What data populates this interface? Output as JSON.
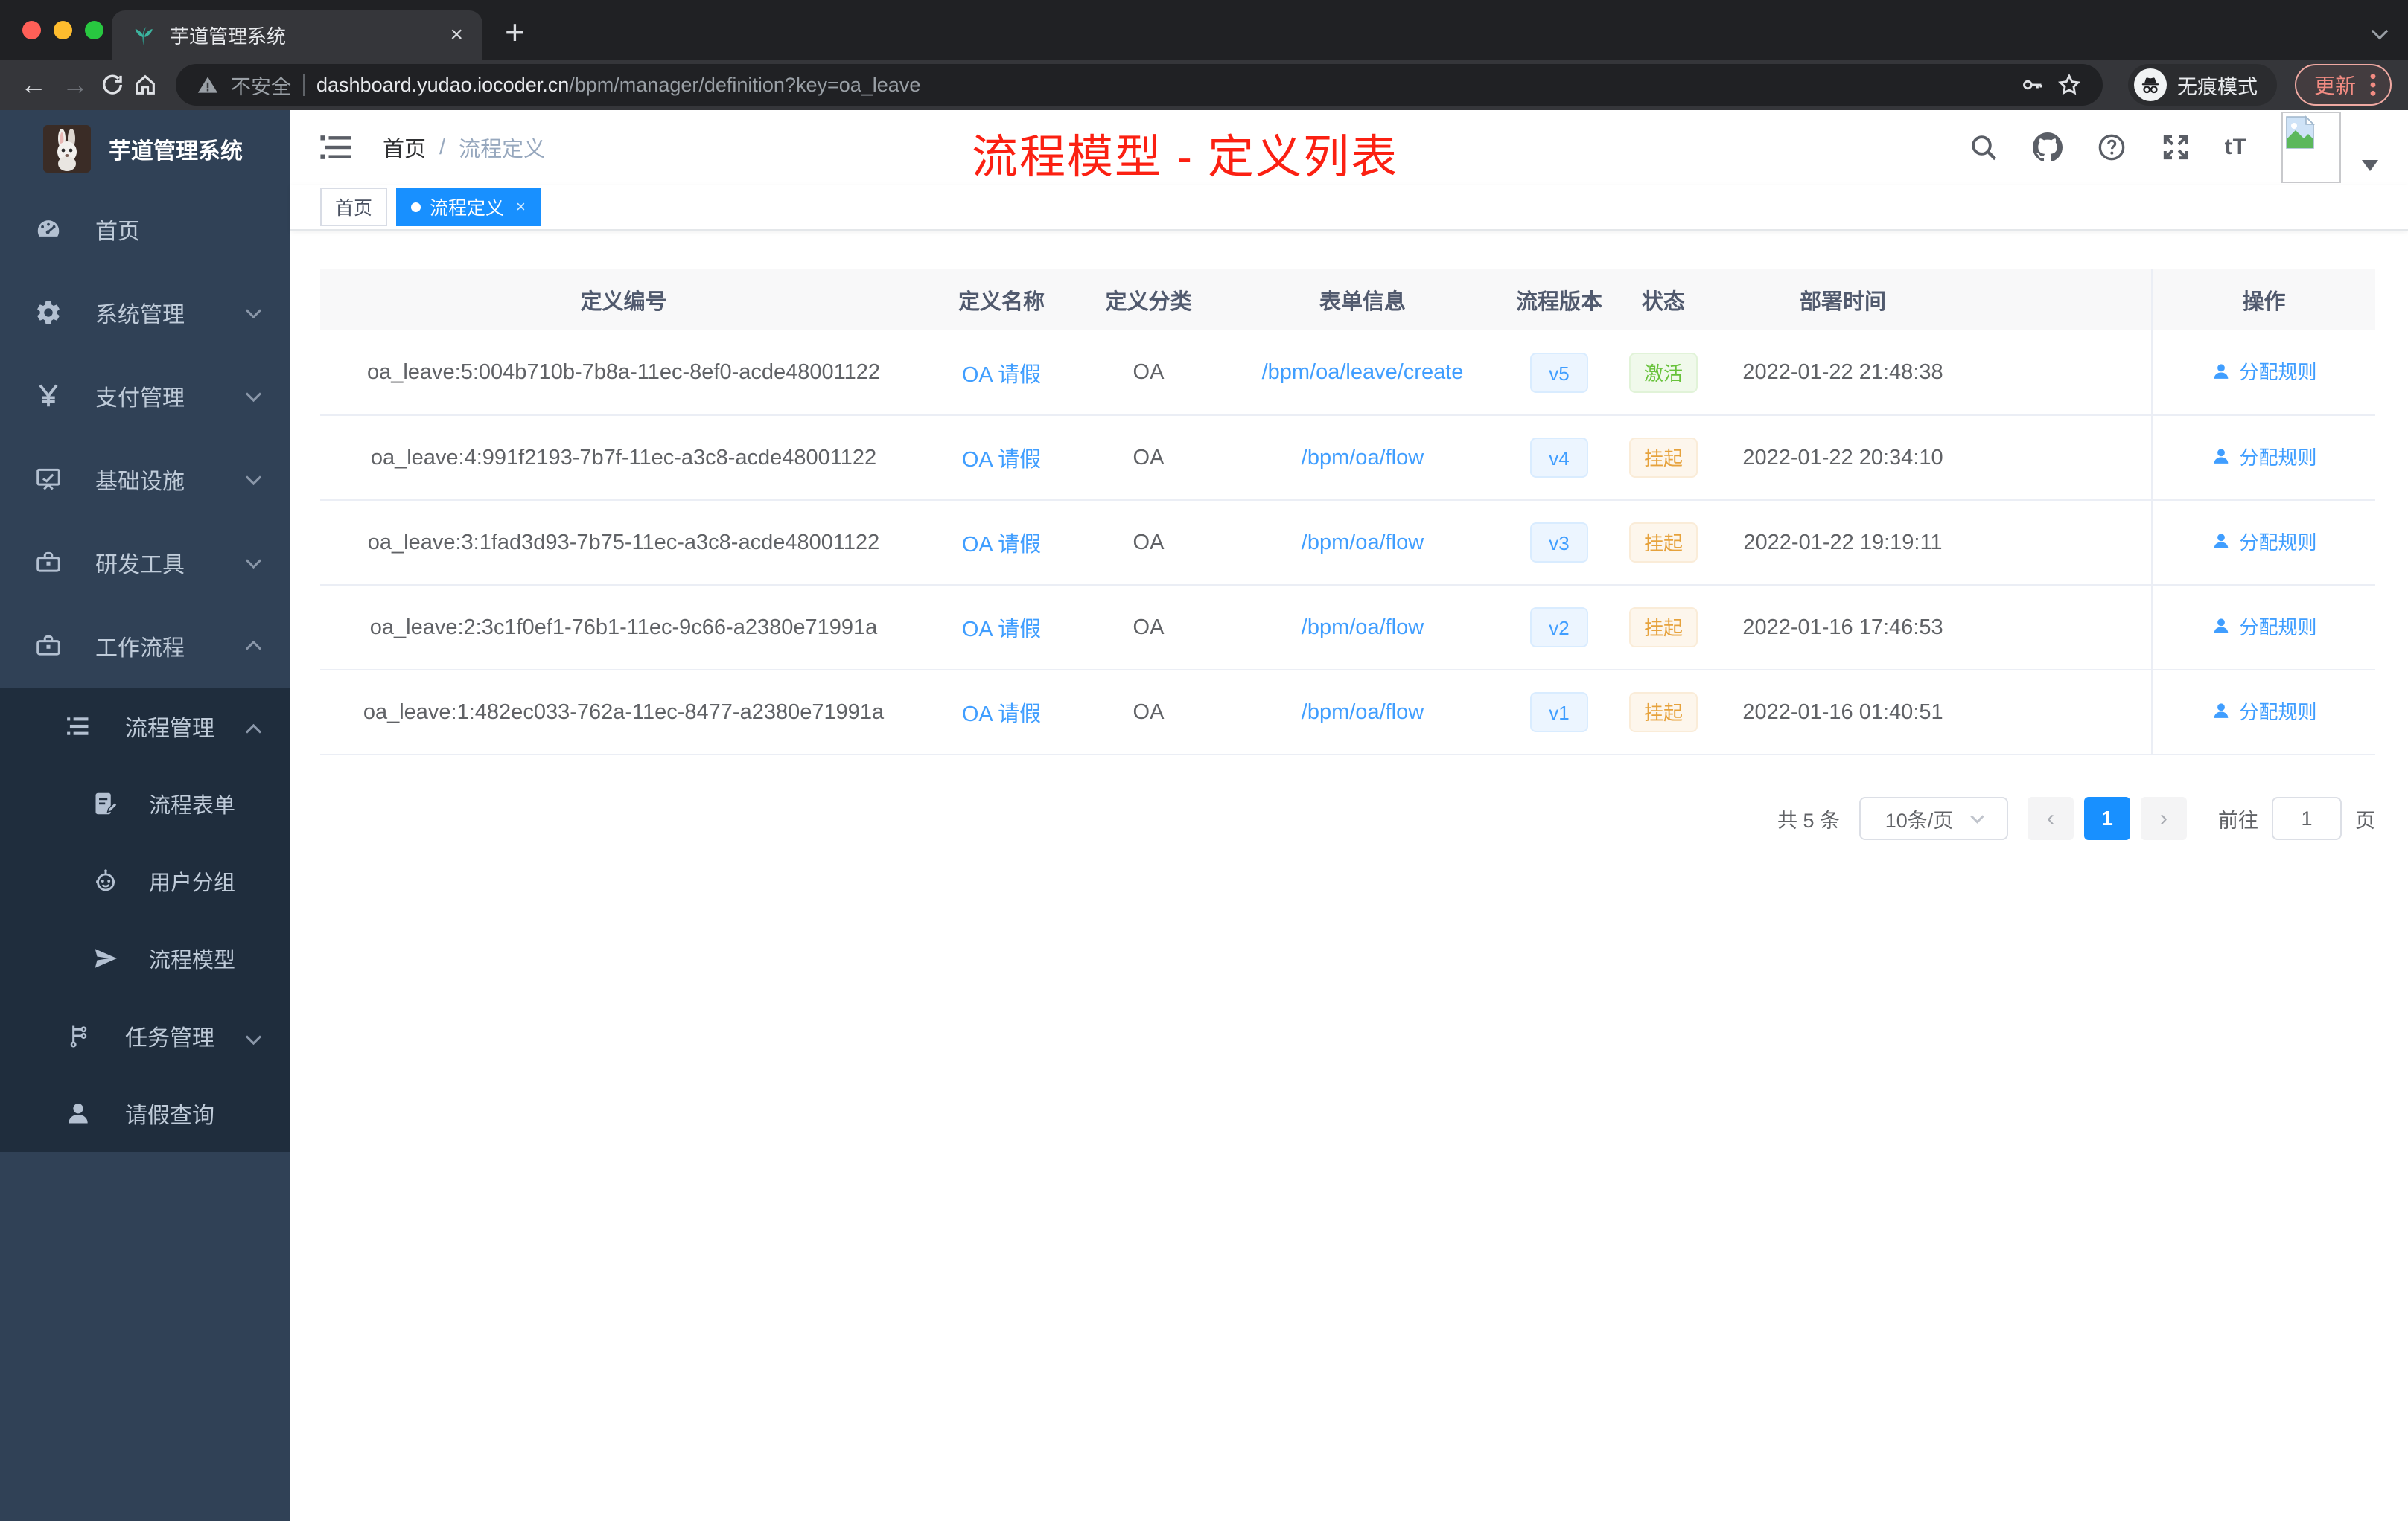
{
  "browser": {
    "tab_title": "芋道管理系统",
    "security_label": "不安全",
    "url_domain": "dashboard.yudao.iocoder.cn",
    "url_path": "/bpm/manager/definition?key=oa_leave",
    "incognito_label": "无痕模式",
    "update_label": "更新",
    "traffic_colors": {
      "close": "#ff5f57",
      "minimize": "#febc2e",
      "maximize": "#28c840"
    }
  },
  "sidebar": {
    "app_title": "芋道管理系统",
    "menu": [
      {
        "label": "首页",
        "icon": "gauge-icon"
      },
      {
        "label": "系统管理",
        "icon": "gear-icon",
        "arrow": "down"
      },
      {
        "label": "支付管理",
        "icon": "yen-icon",
        "arrow": "down"
      },
      {
        "label": "基础设施",
        "icon": "monitor-icon",
        "arrow": "down"
      },
      {
        "label": "研发工具",
        "icon": "toolbox-icon",
        "arrow": "down"
      },
      {
        "label": "工作流程",
        "icon": "briefcase-icon",
        "arrow": "up"
      }
    ],
    "submenu": [
      {
        "label": "流程管理",
        "icon": "list-icon",
        "arrow": "up",
        "level": 1
      },
      {
        "label": "流程表单",
        "icon": "form-icon",
        "level": 2
      },
      {
        "label": "用户分组",
        "icon": "robot-icon",
        "level": 2
      },
      {
        "label": "流程模型",
        "icon": "paper-plane-icon",
        "level": 2
      },
      {
        "label": "任务管理",
        "icon": "flow-tree-icon",
        "arrow": "down",
        "level": 1
      },
      {
        "label": "请假查询",
        "icon": "user-icon",
        "level": 1
      }
    ]
  },
  "header": {
    "breadcrumb_home": "首页",
    "breadcrumb_separator": "/",
    "breadcrumb_current": "流程定义",
    "annotation": "流程模型 - 定义列表",
    "annotation_color": "#fb2012",
    "font_size_icon_label": "tT"
  },
  "tags": {
    "home": "首页",
    "active": "流程定义",
    "active_color": "#1890ff"
  },
  "table": {
    "columns": [
      "定义编号",
      "定义名称",
      "定义分类",
      "表单信息",
      "流程版本",
      "状态",
      "部署时间",
      "操作"
    ],
    "rows": [
      {
        "id": "oa_leave:5:004b710b-7b8a-11ec-8ef0-acde48001122",
        "name": "OA 请假",
        "category": "OA",
        "form": "/bpm/oa/leave/create",
        "version": "v5",
        "status": "激活",
        "status_type": "active",
        "time": "2022-01-22 21:48:38",
        "action": "分配规则"
      },
      {
        "id": "oa_leave:4:991f2193-7b7f-11ec-a3c8-acde48001122",
        "name": "OA 请假",
        "category": "OA",
        "form": "/bpm/oa/flow",
        "version": "v4",
        "status": "挂起",
        "status_type": "suspended",
        "time": "2022-01-22 20:34:10",
        "action": "分配规则"
      },
      {
        "id": "oa_leave:3:1fad3d93-7b75-11ec-a3c8-acde48001122",
        "name": "OA 请假",
        "category": "OA",
        "form": "/bpm/oa/flow",
        "version": "v3",
        "status": "挂起",
        "status_type": "suspended",
        "time": "2022-01-22 19:19:11",
        "action": "分配规则"
      },
      {
        "id": "oa_leave:2:3c1f0ef1-76b1-11ec-9c66-a2380e71991a",
        "name": "OA 请假",
        "category": "OA",
        "form": "/bpm/oa/flow",
        "version": "v2",
        "status": "挂起",
        "status_type": "suspended",
        "time": "2022-01-16 17:46:53",
        "action": "分配规则"
      },
      {
        "id": "oa_leave:1:482ec033-762a-11ec-8477-a2380e71991a",
        "name": "OA 请假",
        "category": "OA",
        "form": "/bpm/oa/flow",
        "version": "v1",
        "status": "挂起",
        "status_type": "suspended",
        "time": "2022-01-16 01:40:51",
        "action": "分配规则"
      }
    ]
  },
  "pagination": {
    "total_label": "共 5 条",
    "page_size": "10条/页",
    "current_page": "1",
    "goto_label": "前往",
    "goto_value": "1",
    "page_unit": "页"
  },
  "colors": {
    "sidebar_bg": "#304156",
    "submenu_bg": "#1f2d3d",
    "link": "#409eff",
    "success": "#67c23a",
    "warning": "#e6a23c",
    "version_tag_bg": "#ecf5ff"
  }
}
